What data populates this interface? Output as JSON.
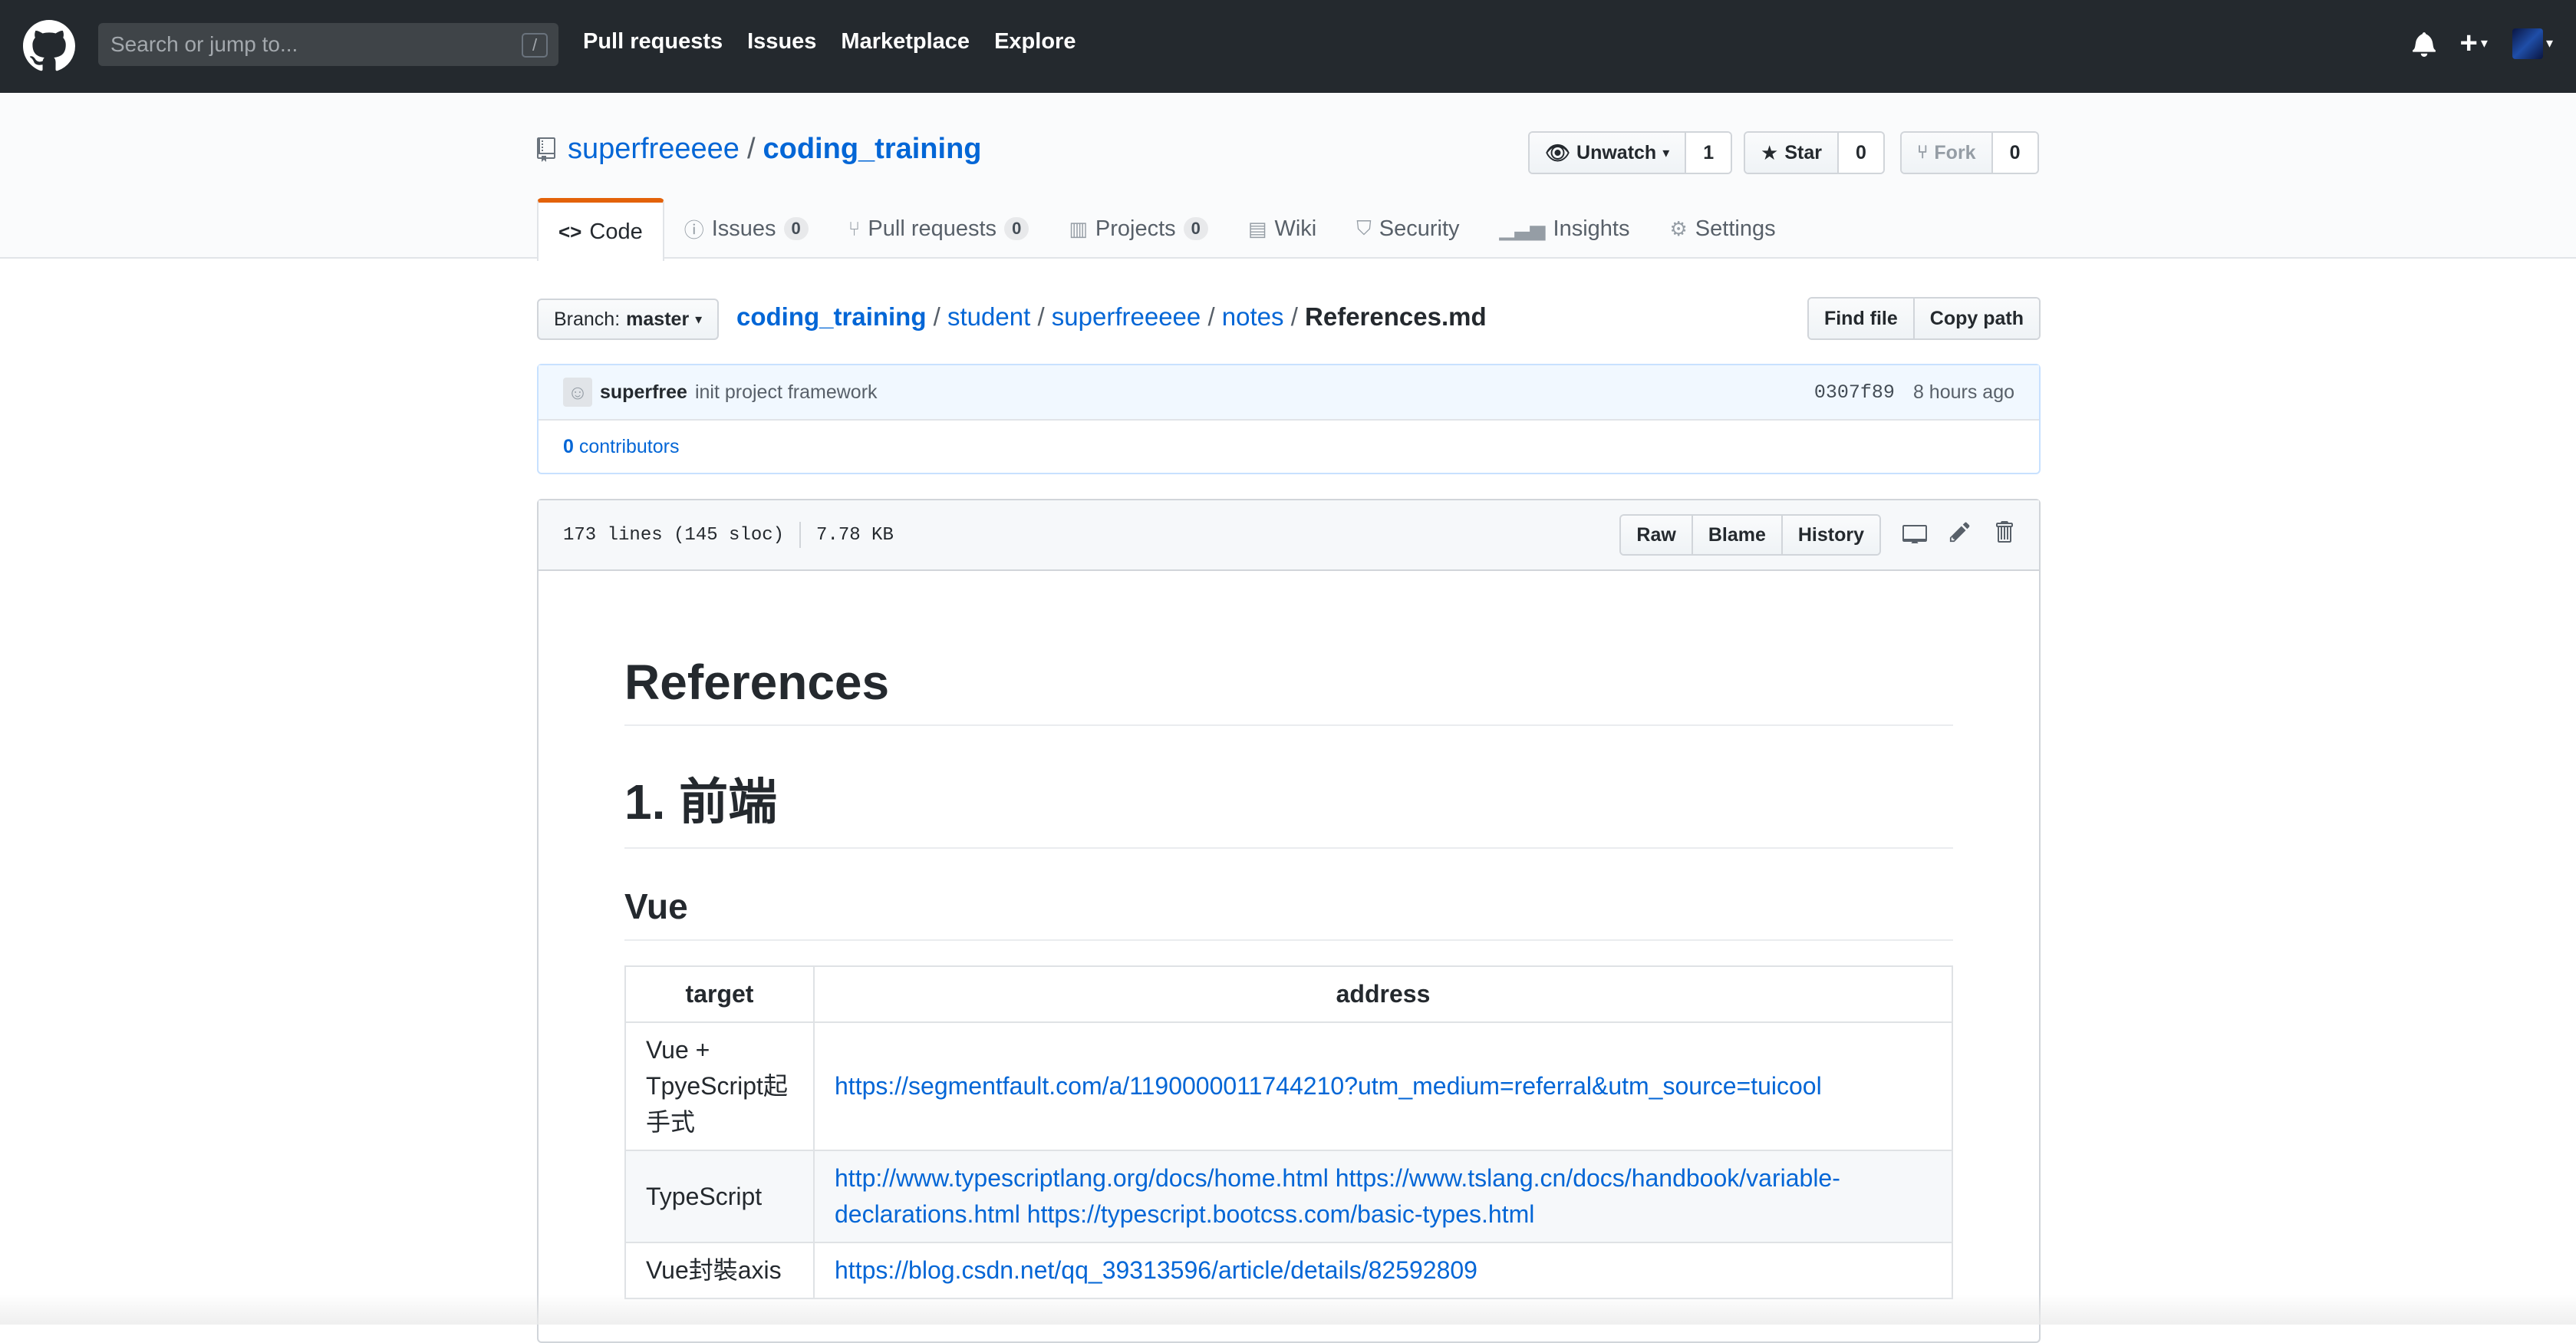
{
  "header": {
    "search_placeholder": "Search or jump to...",
    "search_key": "/",
    "nav": [
      "Pull requests",
      "Issues",
      "Marketplace",
      "Explore"
    ],
    "plus": "+"
  },
  "repo": {
    "owner": "superfreeeee",
    "separator": "/",
    "name": "coding_training",
    "unwatch_label": "Unwatch",
    "watch_count": "1",
    "star_label": "Star",
    "star_count": "0",
    "fork_label": "Fork",
    "fork_count": "0"
  },
  "tabs": [
    {
      "label": "Code",
      "icon": "code-icon"
    },
    {
      "label": "Issues",
      "count": "0",
      "icon": "issue-icon"
    },
    {
      "label": "Pull requests",
      "count": "0",
      "icon": "pull-request-icon"
    },
    {
      "label": "Projects",
      "count": "0",
      "icon": "project-icon"
    },
    {
      "label": "Wiki",
      "icon": "book-icon"
    },
    {
      "label": "Security",
      "icon": "shield-icon"
    },
    {
      "label": "Insights",
      "icon": "graph-icon"
    },
    {
      "label": "Settings",
      "icon": "gear-icon"
    }
  ],
  "file_nav": {
    "branch_prefix": "Branch:",
    "branch": "master",
    "crumbs": [
      "coding_training",
      "student",
      "superfreeeee",
      "notes"
    ],
    "filename": "References.md",
    "find_file": "Find file",
    "copy_path": "Copy path"
  },
  "commit": {
    "author": "superfree",
    "message": "init project framework",
    "sha": "0307f89",
    "time": "8 hours ago",
    "contributors_count": "0",
    "contributors_label": "contributors"
  },
  "file": {
    "lines": "173 lines (145 sloc)",
    "size": "7.78 KB",
    "raw": "Raw",
    "blame": "Blame",
    "history": "History"
  },
  "markdown": {
    "h1": "References",
    "h1b": "1. 前端",
    "h2": "Vue",
    "table_headers": [
      "target",
      "address"
    ],
    "rows": [
      {
        "target": "Vue + TpyeScript起手式",
        "address": "https://segmentfault.com/a/1190000011744210?utm_medium=referral&utm_source=tuicool"
      },
      {
        "target": "TypeScript",
        "address": "http://www.typescriptlang.org/docs/home.html https://www.tslang.cn/docs/handbook/variable-declarations.html https://typescript.bootcss.com/basic-types.html"
      },
      {
        "target": "Vue封裝axis",
        "address": "https://blog.csdn.net/qq_39313596/article/details/82592809"
      }
    ]
  }
}
